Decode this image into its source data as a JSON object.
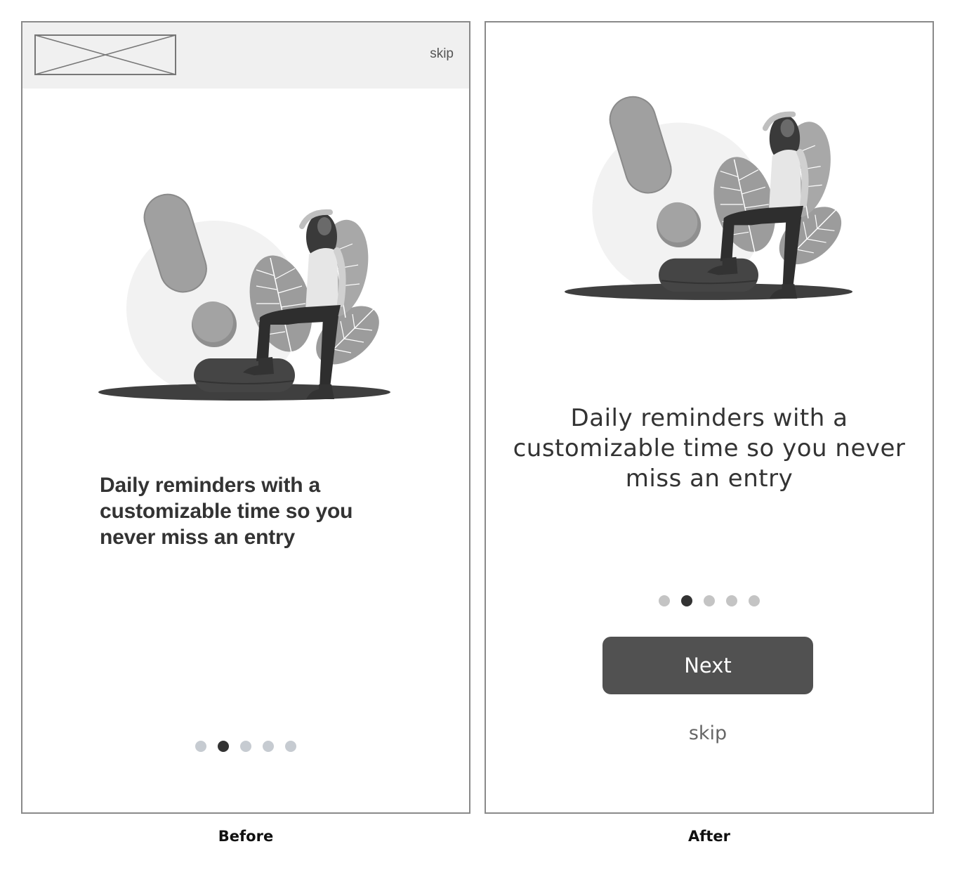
{
  "before": {
    "caption": "Before",
    "skip_label": "skip",
    "headline": "Daily reminders with a customizable time so you never miss an entry",
    "dots": {
      "count": 5,
      "active_index": 1
    }
  },
  "after": {
    "caption": "After",
    "headline": "Daily reminders with a customizable time so you never miss an entry",
    "dots": {
      "count": 5,
      "active_index": 1
    },
    "next_label": "Next",
    "skip_label": "skip"
  },
  "colors": {
    "dark": "#333333",
    "button": "#515151",
    "dot_inactive": "#c6cbd1",
    "topbar": "#f0f0f0",
    "frame_border": "#8a8a8a"
  }
}
